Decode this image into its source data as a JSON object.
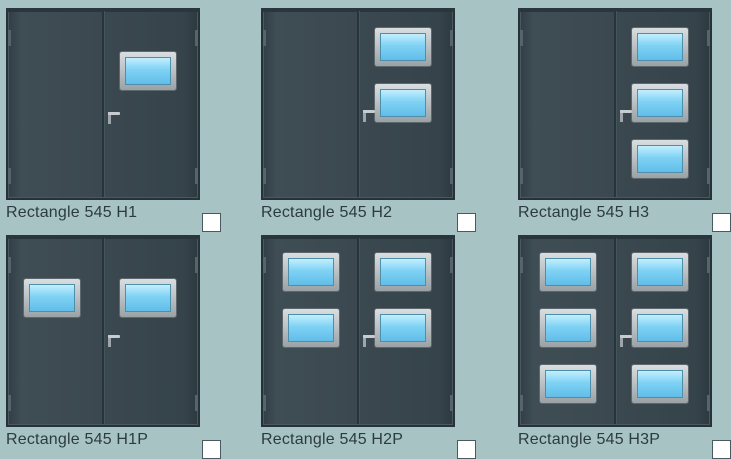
{
  "products": [
    {
      "label": "Rectangle 545 H1",
      "selected": false
    },
    {
      "label": "Rectangle 545 H2",
      "selected": false
    },
    {
      "label": "Rectangle 545 H3",
      "selected": false
    },
    {
      "label": "Rectangle 545 H1P",
      "selected": false
    },
    {
      "label": "Rectangle 545 H2P",
      "selected": false
    },
    {
      "label": "Rectangle 545 H3P",
      "selected": false
    }
  ],
  "colors": {
    "background": "#a7c3c4",
    "door": "#3b4850",
    "glass": "#7fd2f4"
  }
}
